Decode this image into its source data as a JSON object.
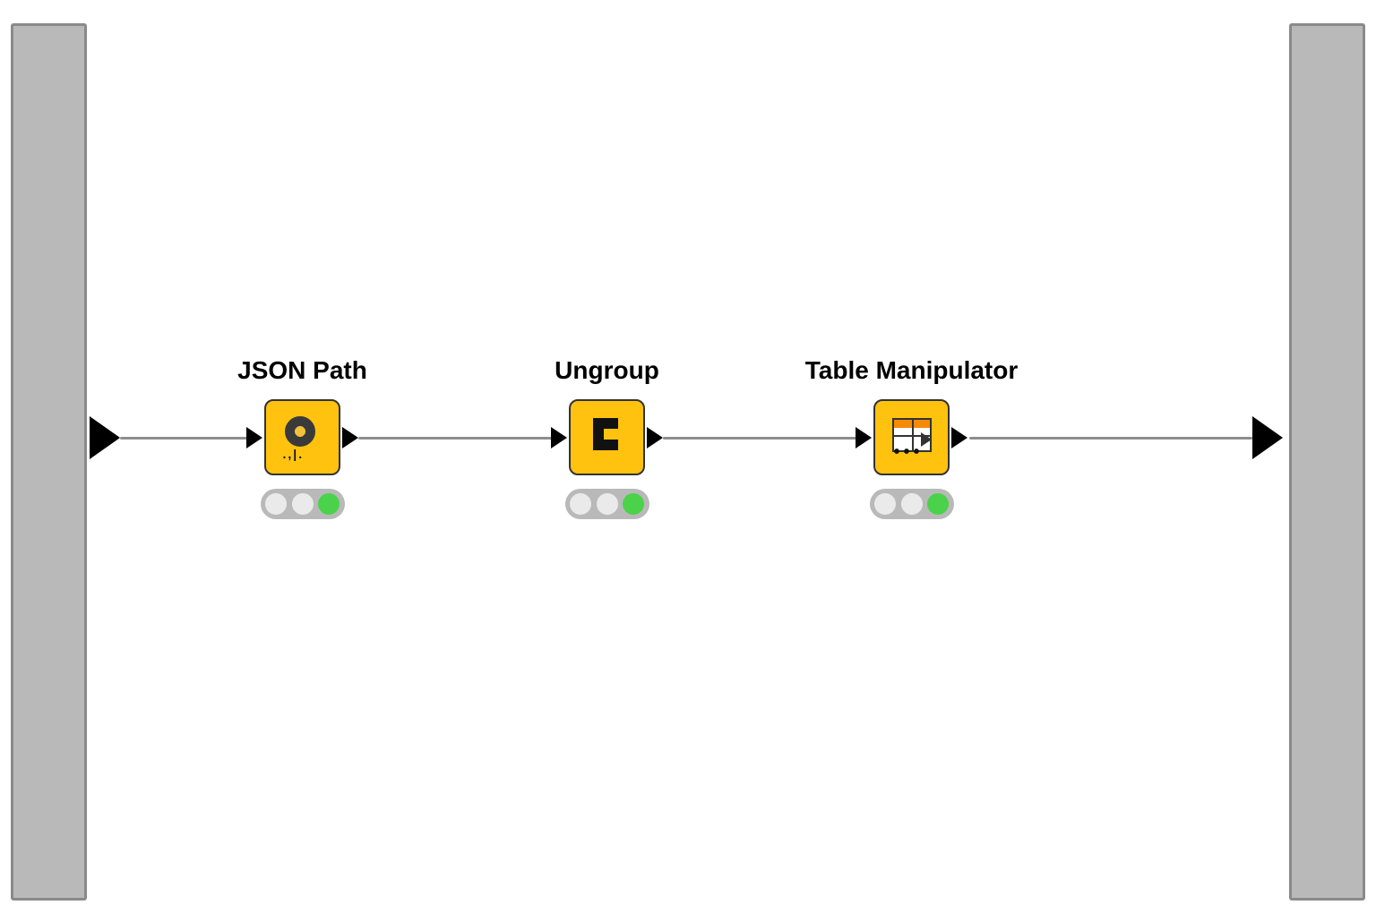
{
  "workflow": {
    "nodes": [
      {
        "id": "json-path",
        "label": "JSON Path",
        "status": "executed",
        "icon": "json-path-icon"
      },
      {
        "id": "ungroup",
        "label": "Ungroup",
        "status": "executed",
        "icon": "ungroup-icon"
      },
      {
        "id": "table-manipulator",
        "label": "Table Manipulator",
        "status": "executed",
        "icon": "table-manipulator-icon"
      }
    ],
    "json_ticks": ".,|."
  }
}
